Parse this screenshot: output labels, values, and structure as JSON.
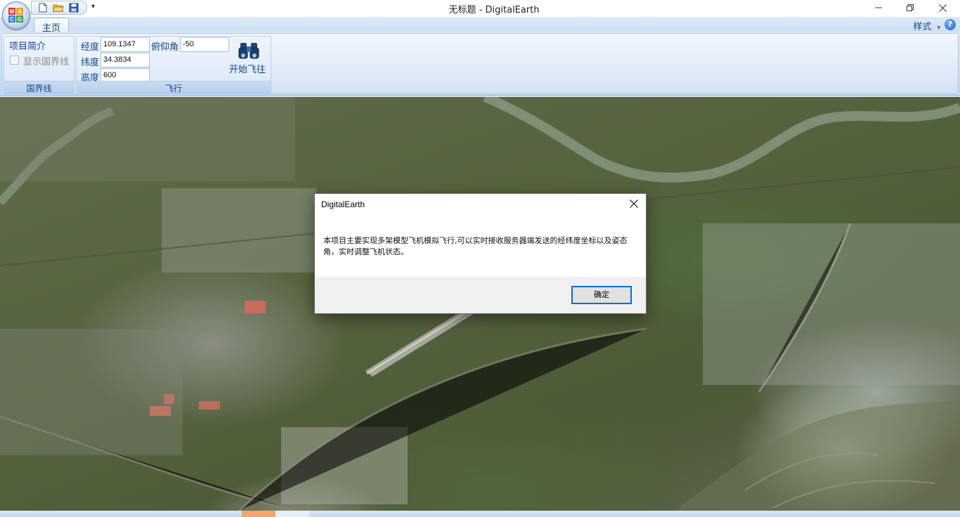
{
  "window": {
    "title": "无标题 - DigitalEarth",
    "minimize_icon": "minimize-icon",
    "maximize_icon": "restore-icon",
    "close_icon": "close-icon"
  },
  "quick_access": {
    "items": [
      "new-file-icon",
      "open-folder-icon",
      "save-icon"
    ],
    "more": "▾"
  },
  "ribbon": {
    "tabs": [
      {
        "label": "主页",
        "active": true
      }
    ],
    "style_menu": "样式",
    "style_arrow": "▾",
    "help": "?",
    "groups": {
      "border": {
        "label": "国界线",
        "intro_label": "项目简介",
        "show_border_label": "显示国界线",
        "show_border_checked": false
      },
      "fly": {
        "label": "飞行",
        "longitude_label": "经度",
        "longitude_value": "109.1347",
        "latitude_label": "纬度",
        "latitude_value": "34.3834",
        "altitude_label": "高度",
        "altitude_value": "600",
        "pitch_label": "俯仰角",
        "pitch_value": "-50",
        "start_label": "开始飞往",
        "start_icon": "binoculars-icon"
      }
    }
  },
  "dialog": {
    "title": "DigitalEarth",
    "message": "本项目主要实现多架模型飞机模拟飞行,可以实时接收服务器端发送的经纬度坐标以及姿态角，实时调整飞机状态。",
    "ok_label": "确定",
    "close_icon": "close-icon"
  },
  "colors": {
    "ribbon_text": "#15428b",
    "dialog_button_border": "#0b6dd3",
    "status_accent": "#f7a36a"
  }
}
